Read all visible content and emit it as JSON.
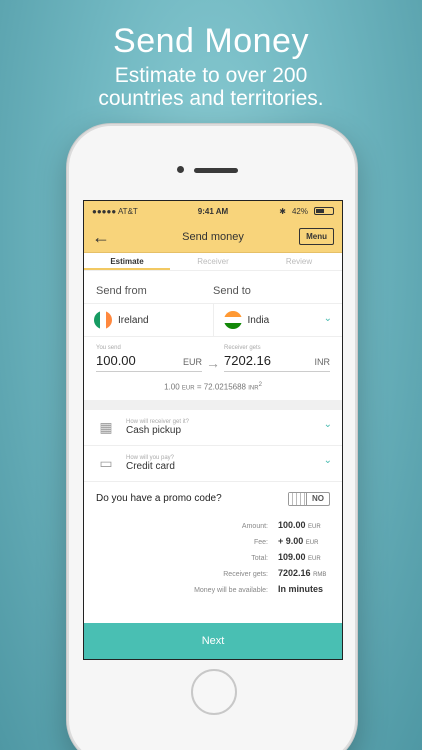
{
  "hero": {
    "title": "Send Money",
    "subtitle_line1": "Estimate to over 200",
    "subtitle_line2": "countries and territories."
  },
  "status_bar": {
    "carrier": "●●●●● AT&T",
    "time": "9:41 AM",
    "battery": "42%"
  },
  "navbar": {
    "back_icon": "←",
    "title": "Send money",
    "menu_label": "Menu"
  },
  "tabs": [
    {
      "label": "Estimate",
      "active": true
    },
    {
      "label": "Receiver",
      "active": false
    },
    {
      "label": "Review",
      "active": false
    }
  ],
  "transfer": {
    "send_from_label": "Send from",
    "send_to_label": "Send to",
    "from_country": "Ireland",
    "to_country": "India",
    "you_send_label": "You send",
    "receiver_gets_label": "Receiver gets",
    "send_amount": "100.00",
    "send_currency": "EUR",
    "receive_amount": "7202.16",
    "receive_currency": "INR",
    "rate_left": "1.00",
    "rate_left_unit": "EUR",
    "rate_eq": "=",
    "rate_right": "72.0215688",
    "rate_right_unit": "INR",
    "rate_footnote": "2"
  },
  "options": {
    "delivery_hint": "How will receiver get it?",
    "delivery_value": "Cash pickup",
    "payment_hint": "How will you pay?",
    "payment_value": "Credit card"
  },
  "promo": {
    "question": "Do you have a promo code?",
    "toggle_label": "NO"
  },
  "summary": [
    {
      "label": "Amount:",
      "value": "100.00",
      "unit": "EUR"
    },
    {
      "label": "Fee:",
      "value": "+ 9.00",
      "unit": "EUR"
    },
    {
      "label": "Total:",
      "value": "109.00",
      "unit": "EUR"
    },
    {
      "label": "Receiver gets:",
      "value": "7202.16",
      "unit": "RMB"
    },
    {
      "label": "Money will be available:",
      "value": "In minutes",
      "unit": ""
    }
  ],
  "next_label": "Next",
  "colors": {
    "header_yellow": "#f8d47b",
    "accent_teal": "#49bfb3",
    "background_teal": "#6fb6c0"
  }
}
